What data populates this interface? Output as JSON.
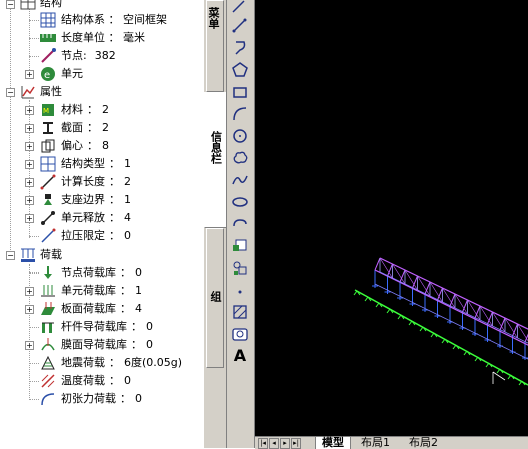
{
  "tree": {
    "structure": {
      "label": "结构",
      "system": {
        "name": "结构体系",
        "value": "空间框架"
      },
      "unit": {
        "name": "长度单位",
        "value": "毫米"
      },
      "nodes": {
        "name": "节点",
        "value": "382"
      },
      "elements": {
        "name": "单元"
      }
    },
    "properties": {
      "label": "属性",
      "items": [
        {
          "name": "材料",
          "value": "2"
        },
        {
          "name": "截面",
          "value": "2"
        },
        {
          "name": "偏心",
          "value": "8"
        },
        {
          "name": "结构类型",
          "value": "1"
        },
        {
          "name": "计算长度",
          "value": "2"
        },
        {
          "name": "支座边界",
          "value": "1"
        },
        {
          "name": "单元释放",
          "value": "4"
        },
        {
          "name": "拉压限定",
          "value": "0"
        }
      ]
    },
    "loads": {
      "label": "荷载",
      "items": [
        {
          "name": "节点荷载库",
          "value": "0"
        },
        {
          "name": "单元荷载库",
          "value": "1"
        },
        {
          "name": "板面荷载库",
          "value": "4"
        },
        {
          "name": "杆件导荷载库",
          "value": "0"
        },
        {
          "name": "膜面导荷载库",
          "value": "0"
        },
        {
          "name": "地震荷载",
          "value": "6度(0.05g)"
        },
        {
          "name": "温度荷载",
          "value": "0"
        },
        {
          "name": "初张力荷载",
          "value": "0"
        }
      ]
    },
    "sep_colon": "：",
    "sep_colon_ascii": ":"
  },
  "tabs": {
    "menu": "菜单",
    "info": "信息栏",
    "group": "组"
  },
  "toolbar": {
    "text_tool": "A"
  },
  "layout_tabs": {
    "model": "模型",
    "layout1": "布局1",
    "layout2": "布局2"
  },
  "colors": {
    "panel": "#d4d0c8",
    "canvas": "#000000",
    "frame_purple": "#c060ff",
    "support_blue": "#3a6cff",
    "ground_green": "#3cff3c"
  }
}
